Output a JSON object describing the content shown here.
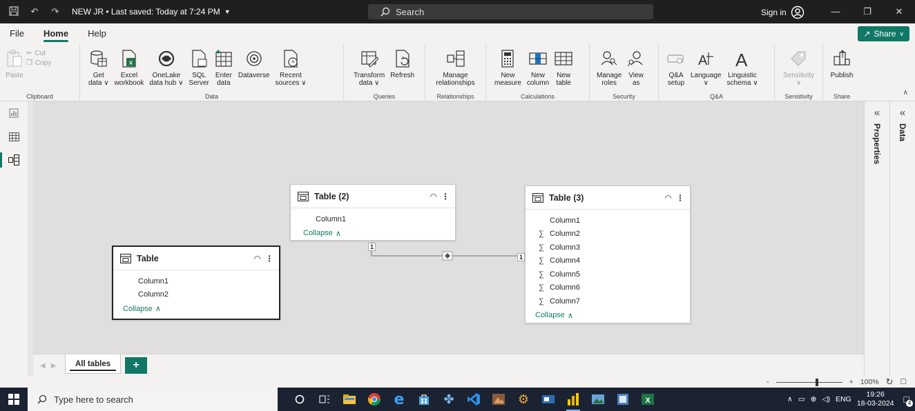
{
  "titlebar": {
    "doc_title": "NEW JR • Last saved: Today at 7:24 PM",
    "search_label": "Search",
    "signin_label": "Sign in"
  },
  "menu": {
    "tabs": [
      {
        "label": "File"
      },
      {
        "label": "Home",
        "active": true
      },
      {
        "label": "Help"
      }
    ],
    "share_label": "Share"
  },
  "ribbon": {
    "clipboard": {
      "paste": "Paste",
      "cut": "Cut",
      "copy": "Copy",
      "label": "Clipboard"
    },
    "data": {
      "label": "Data",
      "buttons": [
        {
          "label": "Get",
          "sub": "data ∨"
        },
        {
          "label": "Excel",
          "sub": "workbook"
        },
        {
          "label": "OneLake",
          "sub": "data hub ∨"
        },
        {
          "label": "SQL",
          "sub": "Server"
        },
        {
          "label": "Enter",
          "sub": "data"
        },
        {
          "label": "Dataverse",
          "sub": ""
        },
        {
          "label": "Recent",
          "sub": "sources ∨"
        }
      ]
    },
    "queries": {
      "label": "Queries",
      "buttons": [
        {
          "label": "Transform",
          "sub": "data ∨"
        },
        {
          "label": "Refresh",
          "sub": ""
        }
      ]
    },
    "relationships": {
      "label": "Relationships",
      "buttons": [
        {
          "label": "Manage",
          "sub": "relationships"
        }
      ]
    },
    "calculations": {
      "label": "Calculations",
      "buttons": [
        {
          "label": "New",
          "sub": "measure"
        },
        {
          "label": "New",
          "sub": "column"
        },
        {
          "label": "New",
          "sub": "table"
        }
      ]
    },
    "security": {
      "label": "Security",
      "buttons": [
        {
          "label": "Manage",
          "sub": "roles"
        },
        {
          "label": "View",
          "sub": "as"
        }
      ]
    },
    "qa": {
      "label": "Q&A",
      "buttons": [
        {
          "label": "Q&A",
          "sub": "setup"
        },
        {
          "label": "Language",
          "sub": "∨"
        },
        {
          "label": "Linguistic",
          "sub": "schema ∨"
        }
      ]
    },
    "sensitivity": {
      "label": "Sensitivity",
      "button": "Sensitivity",
      "sub": "∨"
    },
    "share": {
      "label": "Share",
      "button": "Publish"
    }
  },
  "panes": {
    "properties": "Properties",
    "data": "Data"
  },
  "tables": {
    "table2": {
      "name": "Table (2)",
      "columns": [
        "Column1"
      ],
      "collapse": "Collapse"
    },
    "table3": {
      "name": "Table (3)",
      "columns": [
        {
          "name": "Column1",
          "sum": false
        },
        {
          "name": "Column2",
          "sum": true
        },
        {
          "name": "Column3",
          "sum": true
        },
        {
          "name": "Column4",
          "sum": true
        },
        {
          "name": "Column5",
          "sum": true
        },
        {
          "name": "Column6",
          "sum": true
        },
        {
          "name": "Column7",
          "sum": true
        }
      ],
      "collapse": "Collapse"
    },
    "table1": {
      "name": "Table",
      "columns": [
        "Column1",
        "Column2"
      ],
      "collapse": "Collapse"
    }
  },
  "relationship": {
    "from_card": "1",
    "to_card": "1"
  },
  "bottom": {
    "page_tab": "All tables"
  },
  "status": {
    "zoom": "100%",
    "zoom_level": 1.0
  },
  "taskbar": {
    "search_placeholder": "Type here to search",
    "lang": "ENG",
    "time": "19:26",
    "date": "18-03-2024",
    "notifications": "4"
  },
  "colors": {
    "accent": "#117865",
    "titlebar": "#1f1f1f",
    "taskbar": "#1b2333"
  }
}
